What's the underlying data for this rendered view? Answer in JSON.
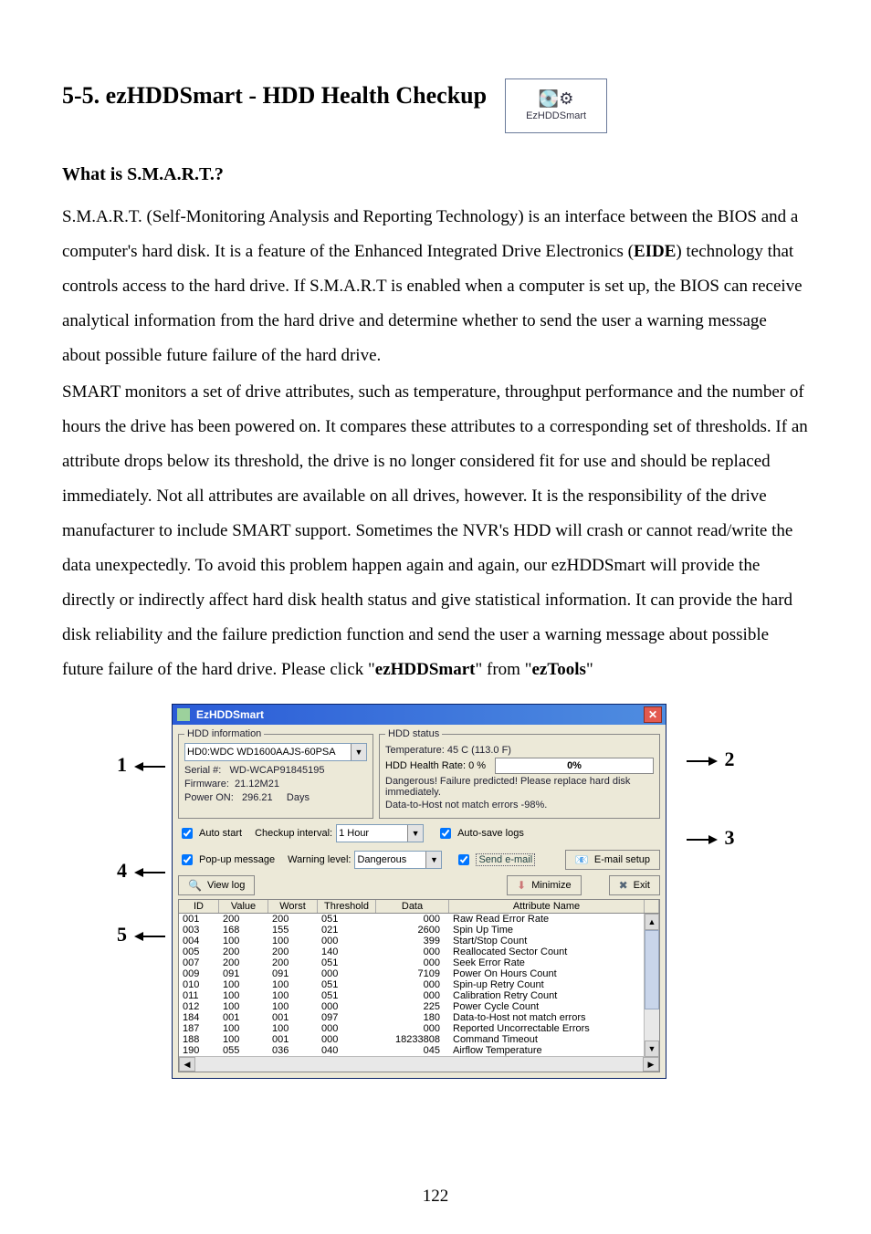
{
  "doc": {
    "title": "5-5.   ezHDDSmart - HDD Health Checkup",
    "iconLabel": "EzHDDSmart",
    "sub": "What is S.M.A.R.T.?",
    "para1_a": "S.M.A.R.T. (Self-Monitoring Analysis and Reporting Technology) is an interface between the BIOS and a computer's hard disk. It is a feature of the Enhanced Integrated Drive Electronics (",
    "para1_bold": "EIDE",
    "para1_b": ") technology that controls access to the hard drive. If S.M.A.R.T is enabled when a computer is set up, the BIOS can receive analytical information from the hard drive and determine whether to send the user a warning message about possible future failure of the hard drive.",
    "para2_a": "SMART monitors a set of drive attributes, such as temperature, throughput performance and the number of hours the drive has been powered on. It compares these attributes to a corresponding set of thresholds. If an attribute drops below its threshold, the drive is no longer considered fit for use and should be replaced immediately. Not all attributes are available on all drives, however. It is the responsibility of the drive manufacturer to include SMART support.    Sometimes the NVR's HDD will crash or cannot read/write the data unexpectedly. To avoid this problem happen again and again, our ezHDDSmart will provide the directly or indirectly affect hard disk health status and give statistical information.    It can provide the hard disk reliability and the failure prediction function and send the user a warning message about possible future failure of the hard drive. Please click \"",
    "para2_b1": "ezHDDSmart",
    "para2_mid": "\" from \"",
    "para2_b2": "ezTools",
    "para2_end": "\"",
    "pageNumber": "122"
  },
  "win": {
    "title": "EzHDDSmart",
    "hddInfo": {
      "legend": "HDD information",
      "drive": "HD0:WDC WD1600AAJS-60PSA",
      "serialLbl": "Serial #:",
      "serial": "WD-WCAP91845195",
      "firmwareLbl": "Firmware:",
      "firmware": "21.12M21",
      "powerOnLbl": "Power ON:",
      "powerOn": "296.21",
      "powerOnUnit": "Days"
    },
    "status": {
      "legend": "HDD status",
      "temp": "Temperature: 45 C (113.0 F)",
      "healthRate": "HDD Health Rate: 0 %",
      "progress": "0%",
      "danger": "Dangerous! Failure predicted! Please replace hard disk immediately.",
      "dataHost": "Data-to-Host not match errors -98%."
    },
    "opts": {
      "autoStart": "Auto start",
      "popup": "Pop-up message",
      "checkupLbl": "Checkup interval:",
      "checkupVal": "1 Hour",
      "warningLbl": "Warning level:",
      "warningVal": "Dangerous",
      "autoSave": "Auto-save logs",
      "sendEmail": "Send e-mail",
      "emailSetupBtn": "E-mail setup"
    },
    "buttons": {
      "viewLog": "View log",
      "minimize": "Minimize",
      "exit": "Exit"
    },
    "table": {
      "headers": {
        "id": "ID",
        "value": "Value",
        "worst": "Worst",
        "threshold": "Threshold",
        "data": "Data",
        "name": "Attribute Name"
      },
      "rows": [
        {
          "id": "001",
          "value": "200",
          "worst": "200",
          "threshold": "051",
          "data": "000",
          "name": "Raw Read Error Rate"
        },
        {
          "id": "003",
          "value": "168",
          "worst": "155",
          "threshold": "021",
          "data": "2600",
          "name": "Spin Up Time"
        },
        {
          "id": "004",
          "value": "100",
          "worst": "100",
          "threshold": "000",
          "data": "399",
          "name": "Start/Stop Count"
        },
        {
          "id": "005",
          "value": "200",
          "worst": "200",
          "threshold": "140",
          "data": "000",
          "name": "Reallocated Sector Count"
        },
        {
          "id": "007",
          "value": "200",
          "worst": "200",
          "threshold": "051",
          "data": "000",
          "name": "Seek Error Rate"
        },
        {
          "id": "009",
          "value": "091",
          "worst": "091",
          "threshold": "000",
          "data": "7109",
          "name": "Power On Hours Count"
        },
        {
          "id": "010",
          "value": "100",
          "worst": "100",
          "threshold": "051",
          "data": "000",
          "name": "Spin-up Retry Count"
        },
        {
          "id": "011",
          "value": "100",
          "worst": "100",
          "threshold": "051",
          "data": "000",
          "name": "Calibration Retry Count"
        },
        {
          "id": "012",
          "value": "100",
          "worst": "100",
          "threshold": "000",
          "data": "225",
          "name": "Power Cycle Count"
        },
        {
          "id": "184",
          "value": "001",
          "worst": "001",
          "threshold": "097",
          "data": "180",
          "name": "Data-to-Host not match errors"
        },
        {
          "id": "187",
          "value": "100",
          "worst": "100",
          "threshold": "000",
          "data": "000",
          "name": "Reported Uncorrectable Errors"
        },
        {
          "id": "188",
          "value": "100",
          "worst": "001",
          "threshold": "000",
          "data": "18233808",
          "name": "Command Timeout"
        },
        {
          "id": "190",
          "value": "055",
          "worst": "036",
          "threshold": "040",
          "data": "045",
          "name": "Airflow Temperature"
        }
      ]
    }
  },
  "callouts": {
    "l1": "1",
    "l2": "2",
    "l3": "3",
    "l4": "4",
    "l5": "5"
  }
}
